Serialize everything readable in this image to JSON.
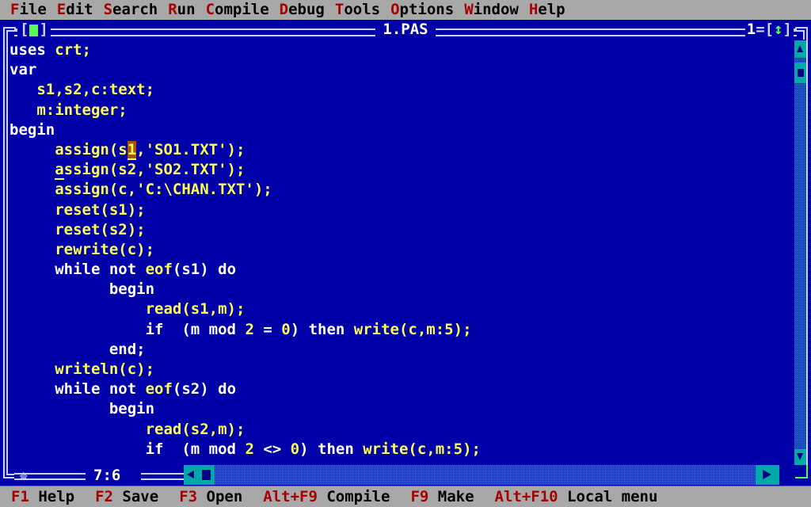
{
  "menubar": {
    "items": [
      {
        "hot": "F",
        "rest": "ile"
      },
      {
        "hot": "E",
        "rest": "dit"
      },
      {
        "hot": "S",
        "rest": "earch"
      },
      {
        "hot": "R",
        "rest": "un"
      },
      {
        "hot": "C",
        "rest": "ompile"
      },
      {
        "hot": "D",
        "rest": "ebug"
      },
      {
        "hot": "T",
        "rest": "ools"
      },
      {
        "hot": "O",
        "rest": "ptions"
      },
      {
        "hot": "W",
        "rest": "indow"
      },
      {
        "hot": "H",
        "rest": "elp"
      }
    ]
  },
  "window": {
    "title": "1.PAS",
    "close_left": "[",
    "close_right": "]",
    "window_number": "1",
    "zoom_prefix": "=[",
    "zoom_arrows": "↕",
    "zoom_suffix": "]",
    "position": "7:6",
    "resize_glyph": "✵"
  },
  "code": {
    "lines": [
      [
        {
          "t": "uses ",
          "c": "kw"
        },
        {
          "t": "crt;",
          "c": "id"
        }
      ],
      [
        {
          "t": "var",
          "c": "kw"
        }
      ],
      [
        {
          "t": "   ",
          "c": "id"
        },
        {
          "t": "s1,s2,c:text;",
          "c": "id"
        }
      ],
      [
        {
          "t": "   ",
          "c": "id"
        },
        {
          "t": "m:integer;",
          "c": "id"
        }
      ],
      [
        {
          "t": "begin",
          "c": "kw"
        }
      ],
      [
        {
          "t": "     assign(s",
          "c": "id"
        },
        {
          "t": "1",
          "c": "cursor"
        },
        {
          "t": ",'SO1.TXT');",
          "c": "id"
        }
      ],
      [
        {
          "t": "     ",
          "c": "id"
        },
        {
          "t": "a",
          "c": "uline"
        },
        {
          "t": "ssign(s2,'SO2.TXT');",
          "c": "id"
        }
      ],
      [
        {
          "t": "     assign(c,'C:\\CHAN.TXT');",
          "c": "id"
        }
      ],
      [
        {
          "t": "     reset(s1);",
          "c": "id"
        }
      ],
      [
        {
          "t": "     reset(s2);",
          "c": "id"
        }
      ],
      [
        {
          "t": "     rewrite(c);",
          "c": "id"
        }
      ],
      [
        {
          "t": "     ",
          "c": "id"
        },
        {
          "t": "while not ",
          "c": "kw"
        },
        {
          "t": "eof",
          "c": "id"
        },
        {
          "t": "(s1) ",
          "c": "kw"
        },
        {
          "t": "do",
          "c": "kw"
        }
      ],
      [
        {
          "t": "           ",
          "c": "id"
        },
        {
          "t": "begin",
          "c": "kw"
        }
      ],
      [
        {
          "t": "               read",
          "c": "id"
        },
        {
          "t": "(s1,m);",
          "c": "id"
        }
      ],
      [
        {
          "t": "               ",
          "c": "id"
        },
        {
          "t": "if  (m ",
          "c": "kw"
        },
        {
          "t": "mod",
          "c": "kw"
        },
        {
          "t": " ",
          "c": "kw"
        },
        {
          "t": "2",
          "c": "id"
        },
        {
          "t": " = ",
          "c": "kw"
        },
        {
          "t": "0",
          "c": "id"
        },
        {
          "t": ") ",
          "c": "kw"
        },
        {
          "t": "then",
          "c": "kw"
        },
        {
          "t": " ",
          "c": "kw"
        },
        {
          "t": "write(c,m:5);",
          "c": "id"
        }
      ],
      [
        {
          "t": "           ",
          "c": "id"
        },
        {
          "t": "end;",
          "c": "kw"
        }
      ],
      [
        {
          "t": "     writeln(c);",
          "c": "id"
        }
      ],
      [
        {
          "t": "     ",
          "c": "id"
        },
        {
          "t": "while not ",
          "c": "kw"
        },
        {
          "t": "eof",
          "c": "id"
        },
        {
          "t": "(s2) ",
          "c": "kw"
        },
        {
          "t": "do",
          "c": "kw"
        }
      ],
      [
        {
          "t": "           ",
          "c": "id"
        },
        {
          "t": "begin",
          "c": "kw"
        }
      ],
      [
        {
          "t": "               read",
          "c": "id"
        },
        {
          "t": "(s2,m);",
          "c": "id"
        }
      ],
      [
        {
          "t": "               ",
          "c": "id"
        },
        {
          "t": "if  (m ",
          "c": "kw"
        },
        {
          "t": "mod",
          "c": "kw"
        },
        {
          "t": " ",
          "c": "kw"
        },
        {
          "t": "2",
          "c": "id"
        },
        {
          "t": " <> ",
          "c": "kw"
        },
        {
          "t": "0",
          "c": "id"
        },
        {
          "t": ") ",
          "c": "kw"
        },
        {
          "t": "then",
          "c": "kw"
        },
        {
          "t": " ",
          "c": "kw"
        },
        {
          "t": "write(c,m:5);",
          "c": "id"
        }
      ]
    ]
  },
  "statusbar": {
    "items": [
      {
        "key": "F1",
        "label": " Help"
      },
      {
        "key": "F2",
        "label": " Save"
      },
      {
        "key": "F3",
        "label": " Open"
      },
      {
        "key": "Alt+F9",
        "label": " Compile"
      },
      {
        "key": "F9",
        "label": " Make"
      },
      {
        "key": "Alt+F10",
        "label": " Local menu"
      }
    ]
  },
  "colors": {
    "desktop_blue": "#0000a8",
    "menu_gray": "#a8a8a8",
    "hotkey_red": "#a80000",
    "identifier_yellow": "#fcfc54",
    "keyword_white": "#ffffff",
    "cursor_brown": "#a85400",
    "scrollbar_cyan": "#00a8a8",
    "accent_green": "#54fc54"
  }
}
